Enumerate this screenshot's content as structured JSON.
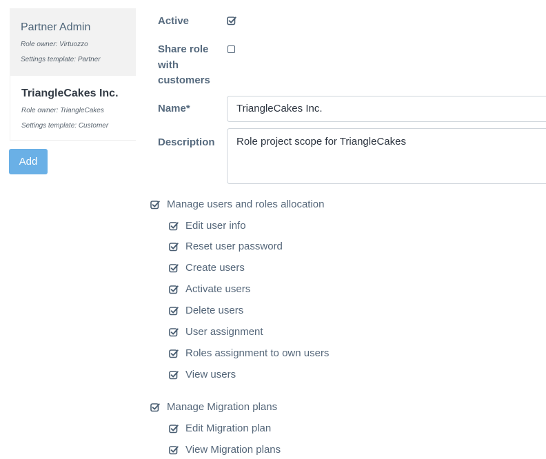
{
  "roles": [
    {
      "title": "Partner Admin",
      "owner": "Role owner: Virtuozzo",
      "template": "Settings template: Partner"
    },
    {
      "title": "TriangleCakes Inc.",
      "owner": "Role owner: TriangleCakes",
      "template": "Settings template: Customer"
    }
  ],
  "add_button": "Add",
  "form": {
    "active_label": "Active",
    "active_checked": true,
    "share_label_1": "Share role",
    "share_label_2": "with",
    "share_label_3": "customers",
    "share_checked": false,
    "name_label": "Name*",
    "name_value": "TriangleCakes Inc.",
    "description_label": "Description",
    "description_value": "Role project scope for TriangleCakes"
  },
  "permissions": [
    {
      "label": "Manage users and roles allocation",
      "checked": true,
      "children": [
        {
          "label": "Edit user info",
          "checked": true
        },
        {
          "label": "Reset user password",
          "checked": true
        },
        {
          "label": "Create users",
          "checked": true
        },
        {
          "label": "Activate users",
          "checked": true
        },
        {
          "label": "Delete users",
          "checked": true
        },
        {
          "label": "User assignment",
          "checked": true
        },
        {
          "label": "Roles assignment to own users",
          "checked": true
        },
        {
          "label": "View users",
          "checked": true
        }
      ]
    },
    {
      "label": "Manage Migration plans",
      "checked": true,
      "children": [
        {
          "label": "Edit Migration plan",
          "checked": true
        },
        {
          "label": "View Migration plans",
          "checked": true
        }
      ]
    }
  ],
  "colors": {
    "add_button_bg": "#6ab0e6",
    "text_primary": "#546679",
    "checkbox_icon": "#4a5e72"
  }
}
